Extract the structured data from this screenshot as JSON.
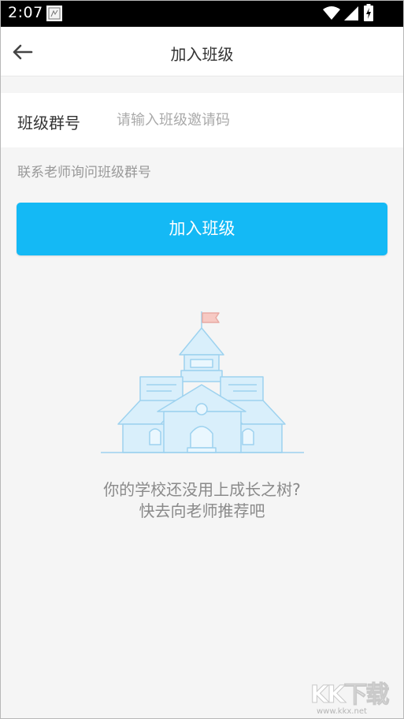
{
  "status_bar": {
    "time": "2:07",
    "notification_icon": "gallery-notification-icon",
    "icons": [
      "wifi-icon",
      "signal-icon",
      "battery-icon"
    ]
  },
  "header": {
    "back_icon": "arrow-left-icon",
    "title": "加入班级"
  },
  "form": {
    "label": "班级群号",
    "value": "",
    "placeholder": "请输入班级邀请码",
    "hint": "联系老师询问班级群号"
  },
  "join_button": {
    "label": "加入班级",
    "color": "#14b9f5"
  },
  "empty_state": {
    "illustration": "school-building-icon",
    "line1": "你的学校还没用上成长之树?",
    "line2": "快去向老师推荐吧"
  },
  "watermark": {
    "logo": "KK下载",
    "url": "www.kkx.net"
  },
  "colors": {
    "accent": "#14b9f5",
    "background": "#f5f5f5"
  }
}
